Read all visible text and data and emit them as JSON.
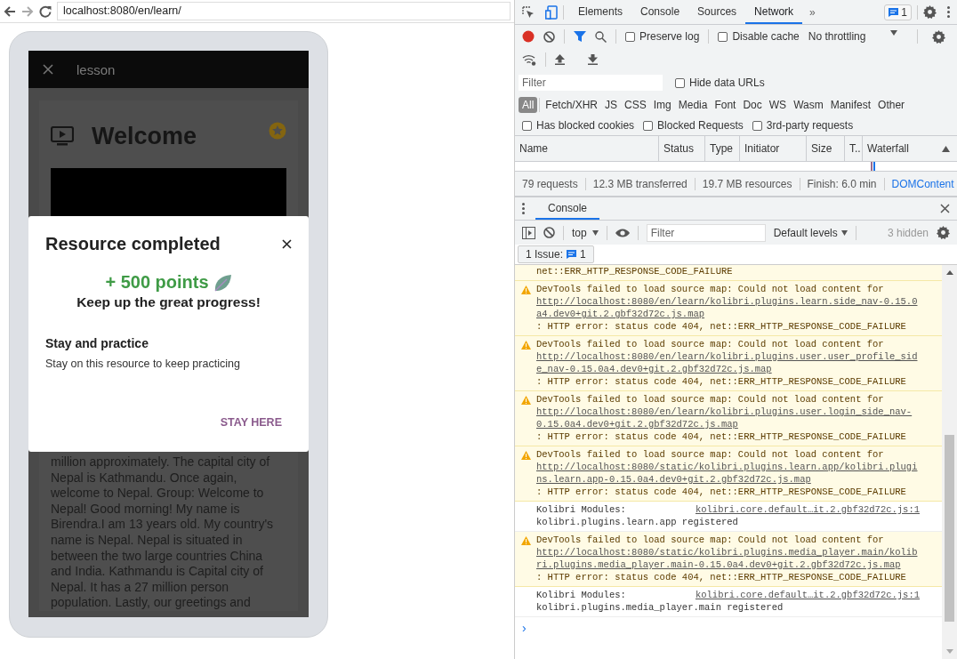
{
  "browser": {
    "url": "localhost:8080/en/learn/"
  },
  "lesson": {
    "top_bar_title": "lesson",
    "content_title": "Welcome",
    "body_text": "million approximately. The capital city of Nepal is Kathmandu. Once again, welcome to Nepal. Group: Welcome to Nepal! Good morning! My name is Birendra.I am 13 years old. My country's name is Nepal. Nepal is situated in between the two large countries China and India. Kathmandu is Capital city of Nepal. It has a 27 million person population. Lastly, our greetings and"
  },
  "modal": {
    "title": "Resource completed",
    "points": "+ 500 points",
    "message": "Keep up the great progress!",
    "option_title": "Stay and practice",
    "option_description": "Stay on this resource to keep practicing",
    "button": "STAY HERE"
  },
  "devtools": {
    "tabs": [
      {
        "label": "Elements",
        "selected": false
      },
      {
        "label": "Console",
        "selected": false
      },
      {
        "label": "Sources",
        "selected": false
      },
      {
        "label": "Network",
        "selected": true
      }
    ],
    "more": "»",
    "issues_count": "1",
    "network": {
      "checkboxes": [
        {
          "label": "Preserve log",
          "checked": false
        },
        {
          "label": "Disable cache",
          "checked": false
        }
      ],
      "throttling": "No throttling",
      "filter_placeholder": "Filter",
      "hide_data_urls": {
        "label": "Hide data URLs",
        "checked": false
      },
      "type_filters": [
        {
          "label": "All",
          "selected": true
        },
        {
          "label": "Fetch/XHR",
          "selected": false
        },
        {
          "label": "JS",
          "selected": false
        },
        {
          "label": "CSS",
          "selected": false
        },
        {
          "label": "Img",
          "selected": false
        },
        {
          "label": "Media",
          "selected": false
        },
        {
          "label": "Font",
          "selected": false
        },
        {
          "label": "Doc",
          "selected": false
        },
        {
          "label": "WS",
          "selected": false
        },
        {
          "label": "Wasm",
          "selected": false
        },
        {
          "label": "Manifest",
          "selected": false
        },
        {
          "label": "Other",
          "selected": false
        }
      ],
      "request_checkboxes": [
        {
          "label": "Has blocked cookies",
          "checked": false
        },
        {
          "label": "Blocked Requests",
          "checked": false
        },
        {
          "label": "3rd-party requests",
          "checked": false
        }
      ],
      "columns": [
        "Name",
        "Status",
        "Type",
        "Initiator",
        "Size",
        "T..",
        "Waterfall"
      ],
      "summary": [
        "79 requests",
        "12.3 MB transferred",
        "19.7 MB resources",
        "Finish: 6.0 min"
      ],
      "summary_link": "DOMContent"
    },
    "drawer": {
      "tabs": [
        {
          "label": "Console",
          "selected": true
        }
      ]
    },
    "console": {
      "context": "top",
      "filter_placeholder": "Filter",
      "levels": "Default levels",
      "hidden": "3 hidden",
      "issues_label": "1 Issue:",
      "issues_count": "1",
      "messages": [
        {
          "kind": "fragment",
          "text": "net::ERR_HTTP_RESPONSE_CODE_FAILURE"
        },
        {
          "kind": "warning",
          "text": "DevTools failed to load source map: Could not load content for ",
          "link": "http://localhost:8080/en/learn/kolibri.plugins.learn.side_nav-0.15.0a4.dev0+git.2.gbf32d72c.js.map",
          "suffix": ": HTTP error: status code 404, net::ERR_HTTP_RESPONSE_CODE_FAILURE"
        },
        {
          "kind": "warning",
          "text": "DevTools failed to load source map: Could not load content for ",
          "link": "http://localhost:8080/en/learn/kolibri.plugins.user.user_profile_side_nav-0.15.0a4.dev0+git.2.gbf32d72c.js.map",
          "suffix": ": HTTP error: status code 404, net::ERR_HTTP_RESPONSE_CODE_FAILURE"
        },
        {
          "kind": "warning",
          "text": "DevTools failed to load source map: Could not load content for ",
          "link": "http://localhost:8080/en/learn/kolibri.plugins.user.login_side_nav-0.15.0a4.dev0+git.2.gbf32d72c.js.map",
          "suffix": ": HTTP error: status code 404, net::ERR_HTTP_RESPONSE_CODE_FAILURE"
        },
        {
          "kind": "warning",
          "text": "DevTools failed to load source map: Could not load content for ",
          "link": "http://localhost:8080/static/kolibri.plugins.learn.app/kolibri.plugins.learn.app-0.15.0a4.dev0+git.2.gbf32d72c.js.map",
          "suffix": ": HTTP error: status code 404, net::ERR_HTTP_RESPONSE_CODE_FAILURE"
        },
        {
          "kind": "log",
          "text": "Kolibri Modules:",
          "source": "kolibri.core.default…it.2.gbf32d72c.js:1",
          "continuation": "kolibri.plugins.learn.app registered"
        },
        {
          "kind": "warning",
          "text": "DevTools failed to load source map: Could not load content for ",
          "link": "http://localhost:8080/static/kolibri.plugins.media_player.main/kolibri.plugins.media_player.main-0.15.0a4.dev0+git.2.gbf32d72c.js.map",
          "suffix": ": HTTP error: status code 404, net::ERR_HTTP_RESPONSE_CODE_FAILURE"
        },
        {
          "kind": "log",
          "text": "Kolibri Modules:",
          "source": "kolibri.core.default…it.2.gbf32d72c.js:1",
          "continuation": "kolibri.plugins.media_player.main registered"
        }
      ],
      "prompt": "›"
    }
  }
}
